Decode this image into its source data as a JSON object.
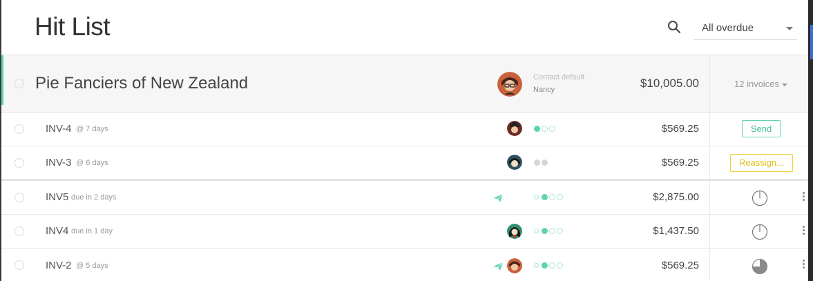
{
  "header": {
    "title": "Hit List",
    "filter_value": "All overdue"
  },
  "group": {
    "name": "Pie Fanciers of New Zealand",
    "contact_label": "Contact default",
    "contact_name": "Nancy",
    "total": "$10,005.00",
    "invoice_count": "12 invoices"
  },
  "invoices": [
    {
      "id": "INV-4",
      "meta": "@ 7 days",
      "amount": "$569.25",
      "action": "Send"
    },
    {
      "id": "INV-3",
      "meta": "@ 6 days",
      "amount": "$569.25",
      "action": "Reassign..."
    },
    {
      "id": "INV5",
      "meta": "due in 2 days",
      "amount": "$2,875.00",
      "progress": 0
    },
    {
      "id": "INV4",
      "meta": "due in 1 day",
      "amount": "$1,437.50",
      "progress": 0
    },
    {
      "id": "INV-2",
      "meta": "@ 5 days",
      "amount": "$569.25",
      "progress": 0.75
    }
  ],
  "colors": {
    "accent": "#5fd3b3",
    "warning": "#f0d23a",
    "group_bg": "#f6f6f6"
  },
  "icons": {
    "search": "search-icon",
    "send": "paper-plane-icon",
    "more": "kebab-menu-icon",
    "progress": "pie-progress-icon"
  }
}
